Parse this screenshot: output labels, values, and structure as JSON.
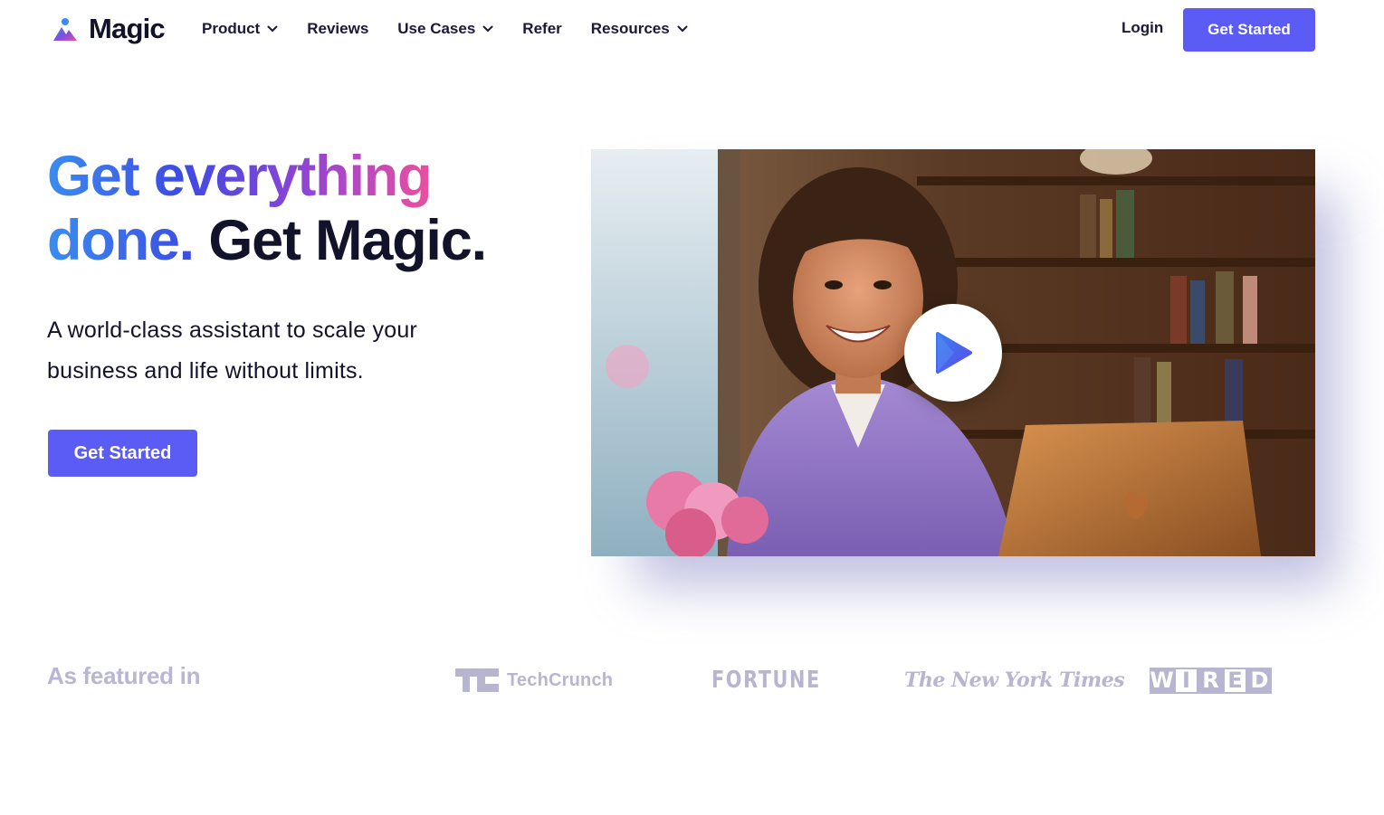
{
  "nav": {
    "logo_text": "Magic",
    "items": [
      {
        "label": "Product",
        "has_dropdown": true
      },
      {
        "label": "Reviews",
        "has_dropdown": false
      },
      {
        "label": "Use Cases",
        "has_dropdown": true
      },
      {
        "label": "Refer",
        "has_dropdown": false
      },
      {
        "label": "Resources",
        "has_dropdown": true
      }
    ],
    "login_label": "Login",
    "cta_label": "Get Started"
  },
  "hero": {
    "headline_part1": "Get everything",
    "headline_part2": "done.",
    "headline_part3": "Get Magic.",
    "subtitle": "A world-class assistant to scale your business and life without limits.",
    "cta_label": "Get Started",
    "video": {
      "play_icon": "play-icon"
    }
  },
  "featured": {
    "label": "As featured in",
    "logos": {
      "techcrunch": {
        "mark": "TC",
        "text": "TechCrunch"
      },
      "fortune": "FORTUNE",
      "nyt": "The New York Times",
      "wired": [
        "W",
        "I",
        "R",
        "E",
        "D"
      ]
    }
  },
  "colors": {
    "primary": "#5b5cf6",
    "text_dark": "#13122b",
    "muted_logo": "#b7b5cf"
  }
}
